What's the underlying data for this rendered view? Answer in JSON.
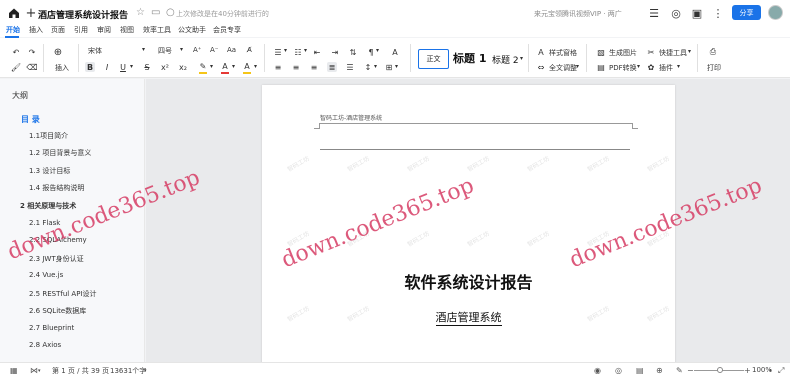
{
  "titlebar": {
    "title": "酒店管理系统设计报告",
    "save_status": "上次修改是在40分钟前进行的",
    "user_info": "来元宝领腾讯视频VIP · 两广",
    "share_label": "分享"
  },
  "menu": {
    "tabs": [
      "开始",
      "插入",
      "页面",
      "引用",
      "审阅",
      "视图",
      "效率工具",
      "公文助手",
      "会员专享"
    ]
  },
  "toolbar": {
    "insert_label": "插入",
    "font_family": "宋体",
    "font_size": "四号",
    "style_normal": "正文",
    "style_h1": "标题 1",
    "style_h2": "标题 2",
    "format_painter": "样式窗格",
    "full_text_adjust": "全文调整",
    "gen_image": "生成图片",
    "quick_tools": "快捷工具",
    "pdf_convert": "PDF转换",
    "plugins": "插件",
    "print": "打印",
    "colors": {
      "highlight": "#f5c518",
      "font_color": "#e53935",
      "accent": "#1a73e8"
    }
  },
  "outline": {
    "title": "大纲",
    "items": [
      {
        "text": "目 录",
        "level": 0
      },
      {
        "text": "1.1项目简介",
        "level": 2
      },
      {
        "text": "1.2  项目背景与意义",
        "level": 2
      },
      {
        "text": "1.3  设计目标",
        "level": 2
      },
      {
        "text": "1.4  报告结构说明",
        "level": 2
      },
      {
        "text": "2  相关原理与技术",
        "level": 1
      },
      {
        "text": "2.1  Flask",
        "level": 2
      },
      {
        "text": "2.2  SQLAlchemy",
        "level": 2
      },
      {
        "text": "2.3  JWT身份认证",
        "level": 2
      },
      {
        "text": "2.4  Vue.js",
        "level": 2
      },
      {
        "text": "2.5  RESTful  API设计",
        "level": 2
      },
      {
        "text": "2.6  SQLite数据库",
        "level": 2
      },
      {
        "text": "2.7  Blueprint",
        "level": 2
      },
      {
        "text": "2.8  Axios",
        "level": 2
      }
    ]
  },
  "document": {
    "header_text": "智码工坊-酒店管理系统",
    "heading": "软件系统设计报告",
    "subheading": "酒店管理系统"
  },
  "watermark": {
    "big_text": "down.code365.top",
    "small_text": "智码工坊"
  },
  "statusbar": {
    "page_info": "第 1 页 / 共 39 页",
    "word_count": "13631个字",
    "zoom": "100%"
  }
}
